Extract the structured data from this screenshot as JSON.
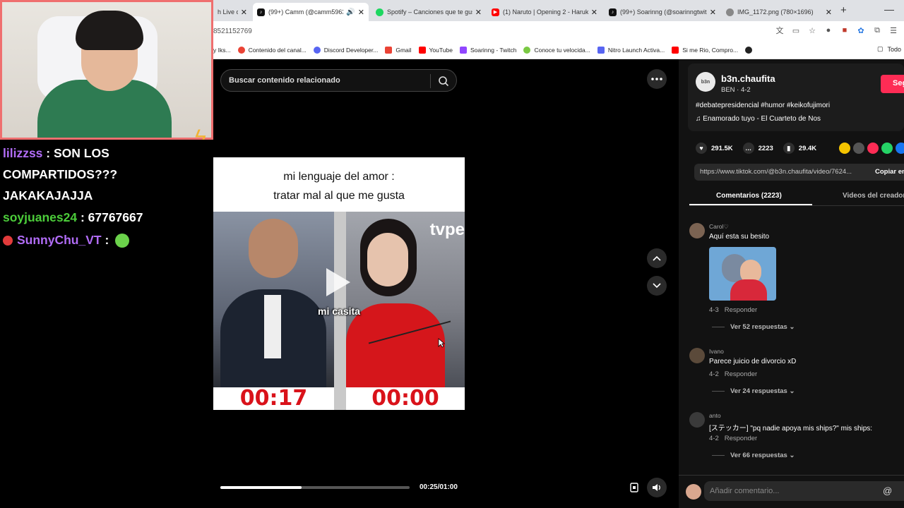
{
  "browser": {
    "tabs": [
      {
        "label": "h Live c",
        "color": "#ffffff"
      },
      {
        "label": "(99+) Camm (@camm5963)",
        "color": "#111111",
        "active": true
      },
      {
        "label": "Spotify – Canciones que te gus",
        "color": "#1ed760"
      },
      {
        "label": "(1) Naruto | Opening 2 - Haruk",
        "color": "#ff0000"
      },
      {
        "label": "(99+) Soarinng (@soarinngtwit",
        "color": "#111111"
      },
      {
        "label": "IMG_1172.png (780×1696)",
        "color": "#888888"
      }
    ],
    "url": "8521152769",
    "bookmarks": [
      {
        "label": "y Iks...",
        "color": "#ffffff"
      },
      {
        "label": "Contenido del canal...",
        "color": "#ea4335"
      },
      {
        "label": "Discord Developer...",
        "color": "#5865f2"
      },
      {
        "label": "Gmail",
        "color": "#ea4335"
      },
      {
        "label": "YouTube",
        "color": "#ff0000"
      },
      {
        "label": "Soarinng - Twitch",
        "color": "#9146ff"
      },
      {
        "label": "Conoce tu velocida...",
        "color": "#7ac943"
      },
      {
        "label": "Nitro Launch Activa...",
        "color": "#5865f2"
      },
      {
        "label": "Si me Rio, Compro...",
        "color": "#ff0000"
      }
    ],
    "bookmarks_right": "Todo"
  },
  "chat": {
    "messages": [
      {
        "user": "lilizzss",
        "user_color": "#b16cf6",
        "text": ": SON LOS COMPARTIDOS??? JAKAKAJAJJA"
      },
      {
        "user": "soyjuanes24",
        "user_color": "#4ccd3a",
        "text": ": 67767667"
      },
      {
        "user": "SunnyChu_VT",
        "user_color": "#b16cf6",
        "text": ":"
      }
    ]
  },
  "video": {
    "search_placeholder": "Buscar contenido relacionado",
    "caption_line1": "mi lenguaje del amor :",
    "caption_line2": "tratar mal al que me gusta",
    "subtitle": "mi casita",
    "tv_logo": "tvpe",
    "timer_left": "00:17",
    "timer_right": "00:00",
    "time": "00:25/01:00",
    "progress": 0.43
  },
  "post": {
    "avatar_text": "b3n",
    "username": "b3n.chaufita",
    "sub": "BEN · 4-2",
    "follow_label": "Seguir",
    "tags": "#debatepresidencial #humor #keikofujimori",
    "music": "Enamorado tuyo - El Cuarteto de Nos",
    "likes": "291.5K",
    "comments": "2223",
    "saves": "29.4K",
    "share_colors": [
      "#f5c400",
      "#555555",
      "#fe2c55",
      "#25d366",
      "#1877f2"
    ],
    "link": "https://www.tiktok.com/@b3n.chaufita/video/7624...",
    "copy_label": "Copiar enlace",
    "tab_comments": "Comentarios (2223)",
    "tab_creator": "Videos del creador"
  },
  "comments": [
    {
      "user": "Carol♡",
      "text": "Aquí esta su besito",
      "date": "4-3",
      "reply": "Responder",
      "replies": "Ver 52 respuestas"
    },
    {
      "user": "Ivano",
      "text": "Parece juicio de divorcio xD",
      "date": "4-2",
      "reply": "Responder",
      "replies": "Ver 24 respuestas"
    },
    {
      "user": "anto",
      "text": "[ステッカー] \"pq nadie apoya mis ships?\" mis ships:",
      "date": "4-2",
      "reply": "Responder",
      "replies": "Ver 66 respuestas"
    }
  ],
  "add_comment_placeholder": "Añadir comentario..."
}
